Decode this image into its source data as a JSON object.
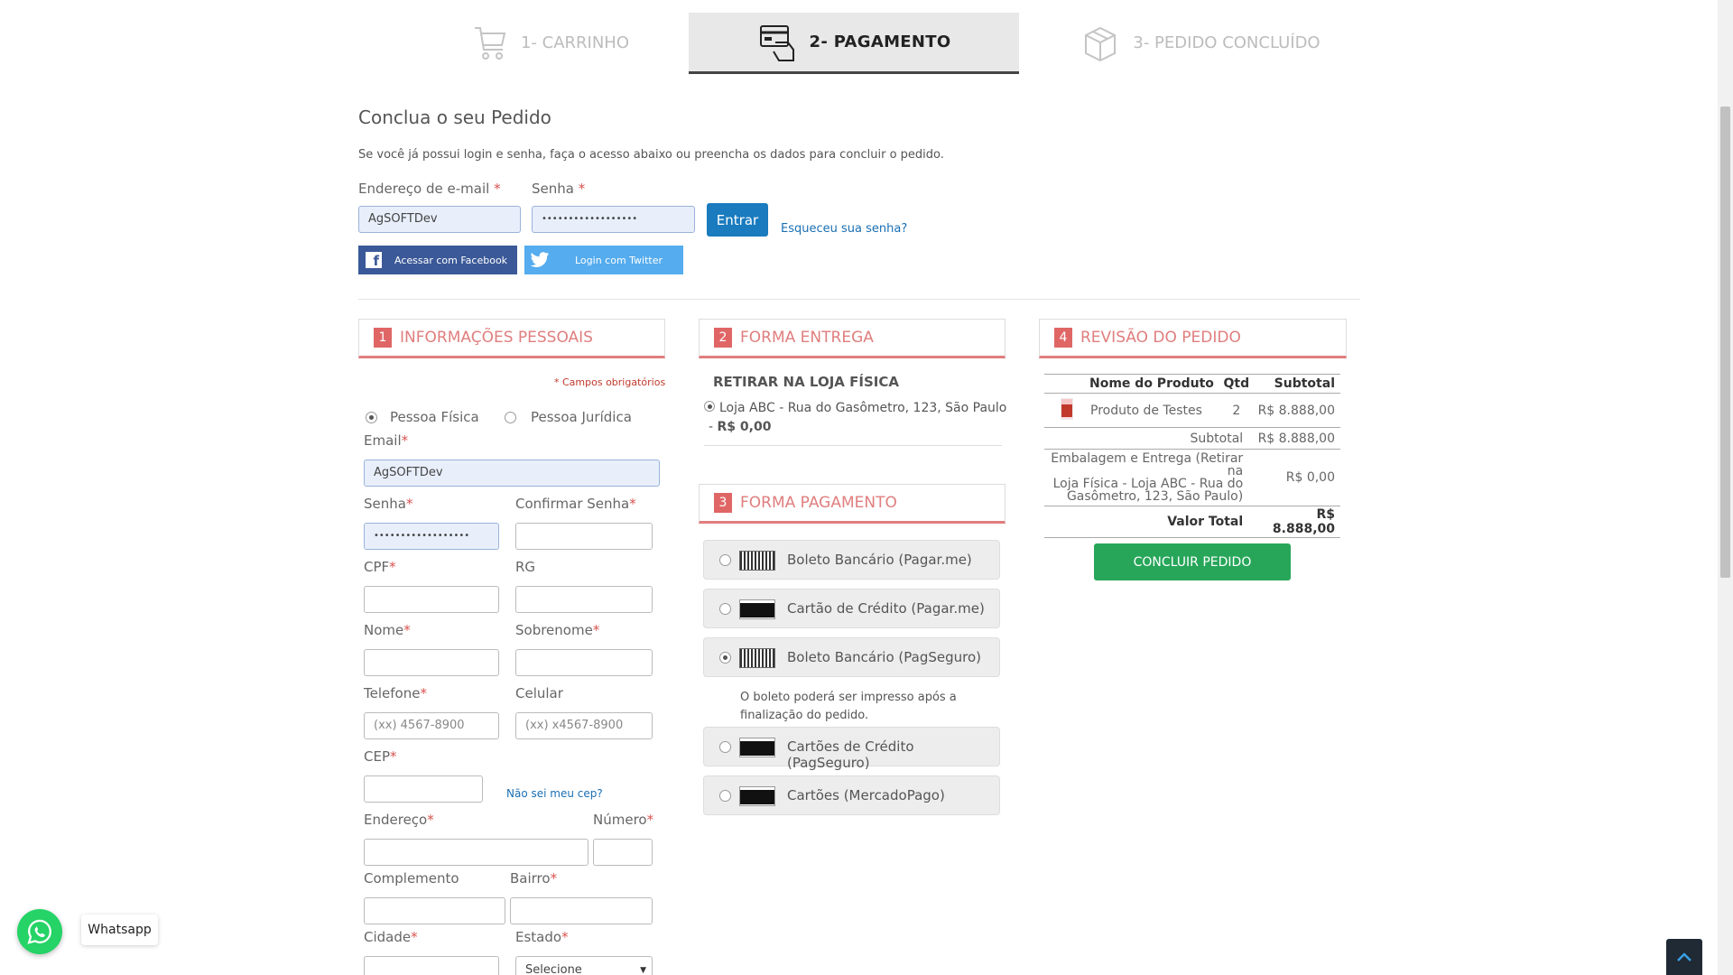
{
  "steps": [
    {
      "label": "1- CARRINHO",
      "icon": "cart-icon"
    },
    {
      "label": "2- PAGAMENTO",
      "icon": "payment-icon"
    },
    {
      "label": "3- PEDIDO CONCLUÍDO",
      "icon": "box-icon"
    }
  ],
  "login": {
    "title": "Conclua o seu Pedido",
    "intro": "Se você já possui login e senha, faça o acesso abaixo ou preencha os dados para concluir o pedido.",
    "email_label": "Endereço de e-mail",
    "email_value": "AgSOFTDev",
    "password_label": "Senha",
    "password_value": "••••••••••••••••••",
    "enter_button": "Entrar",
    "forgot_link": "Esqueceu sua senha?",
    "facebook_button": "Acessar com Facebook",
    "twitter_button": "Login com Twitter",
    "required_mark": "*"
  },
  "personal": {
    "number": "1",
    "title": "INFORMAÇÕES PESSOAIS",
    "required_note": "* Campos obrigatórios",
    "person_fisica": "Pessoa Física",
    "person_juridica": "Pessoa Jurídica",
    "email_label": "Email",
    "email_value": "AgSOFTDev",
    "senha_label": "Senha",
    "senha_value": "••••••••••••••••••",
    "confirm_label": "Confirmar Senha",
    "cpf_label": "CPF",
    "rg_label": "RG",
    "nome_label": "Nome",
    "sobrenome_label": "Sobrenome",
    "telefone_label": "Telefone",
    "telefone_placeholder": "(xx) 4567-8900",
    "celular_label": "Celular",
    "celular_placeholder": "(xx) x4567-8900",
    "cep_label": "CEP",
    "cep_link": "Não sei meu cep?",
    "endereco_label": "Endereço",
    "numero_label": "Número",
    "complemento_label": "Complemento",
    "bairro_label": "Bairro",
    "cidade_label": "Cidade",
    "estado_label": "Estado",
    "estado_value": "Selecione",
    "star": "*"
  },
  "delivery": {
    "number": "2",
    "title": "FORMA ENTREGA",
    "option_title": "RETIRAR NA LOJA FÍSICA",
    "option_text": "Loja ABC - Rua do Gasômetro, 123, São Paulo",
    "option_price_prefix": "- ",
    "option_price": "R$ 0,00"
  },
  "payment": {
    "number": "3",
    "title": "FORMA PAGAMENTO",
    "options": [
      {
        "label": "Boleto Bancário (Pagar.me)",
        "icon": "boleto-icon",
        "selected": false
      },
      {
        "label": "Cartão de Crédito (Pagar.me)",
        "icon": "credit-card-icon",
        "selected": false
      },
      {
        "label": "Boleto Bancário (PagSeguro)",
        "icon": "boleto-icon",
        "selected": true
      },
      {
        "label": "Cartões de Crédito (PagSeguro)",
        "icon": "credit-card-icon",
        "selected": false
      },
      {
        "label": "Cartões (MercadoPago)",
        "icon": "credit-card-icon",
        "selected": false
      }
    ],
    "boleto_note_1": "O boleto poderá ser impresso após a",
    "boleto_note_2": "finalização do pedido."
  },
  "review": {
    "number": "4",
    "title": "REVISÃO DO PEDIDO",
    "col_product": "Nome do Produto",
    "col_qty": "Qtd",
    "col_subtotal": "Subtotal",
    "product_name": "Produto de Testes",
    "product_qty": "2",
    "product_subtotal": "R$ 8.888,00",
    "subtotal_label": "Subtotal",
    "subtotal_value": "R$ 8.888,00",
    "shipping_line1": "Embalagem e Entrega (Retirar na",
    "shipping_line2": "Loja Física - Loja ABC - Rua do",
    "shipping_line3": "Gasômetro, 123, São Paulo)",
    "shipping_value": "R$ 0,00",
    "total_label": "Valor Total",
    "total_value": "R$ 8.888,00",
    "submit_button": "CONCLUIR PEDIDO"
  },
  "whatsapp": {
    "label": "Whatsapp"
  },
  "colors": {
    "accent_red": "#e07e7e",
    "facebook": "#3b5998",
    "twitter": "#55acee",
    "enter_button": "#1a7bbf",
    "submit_green": "#27a65a",
    "whatsapp_green": "#25d366"
  }
}
